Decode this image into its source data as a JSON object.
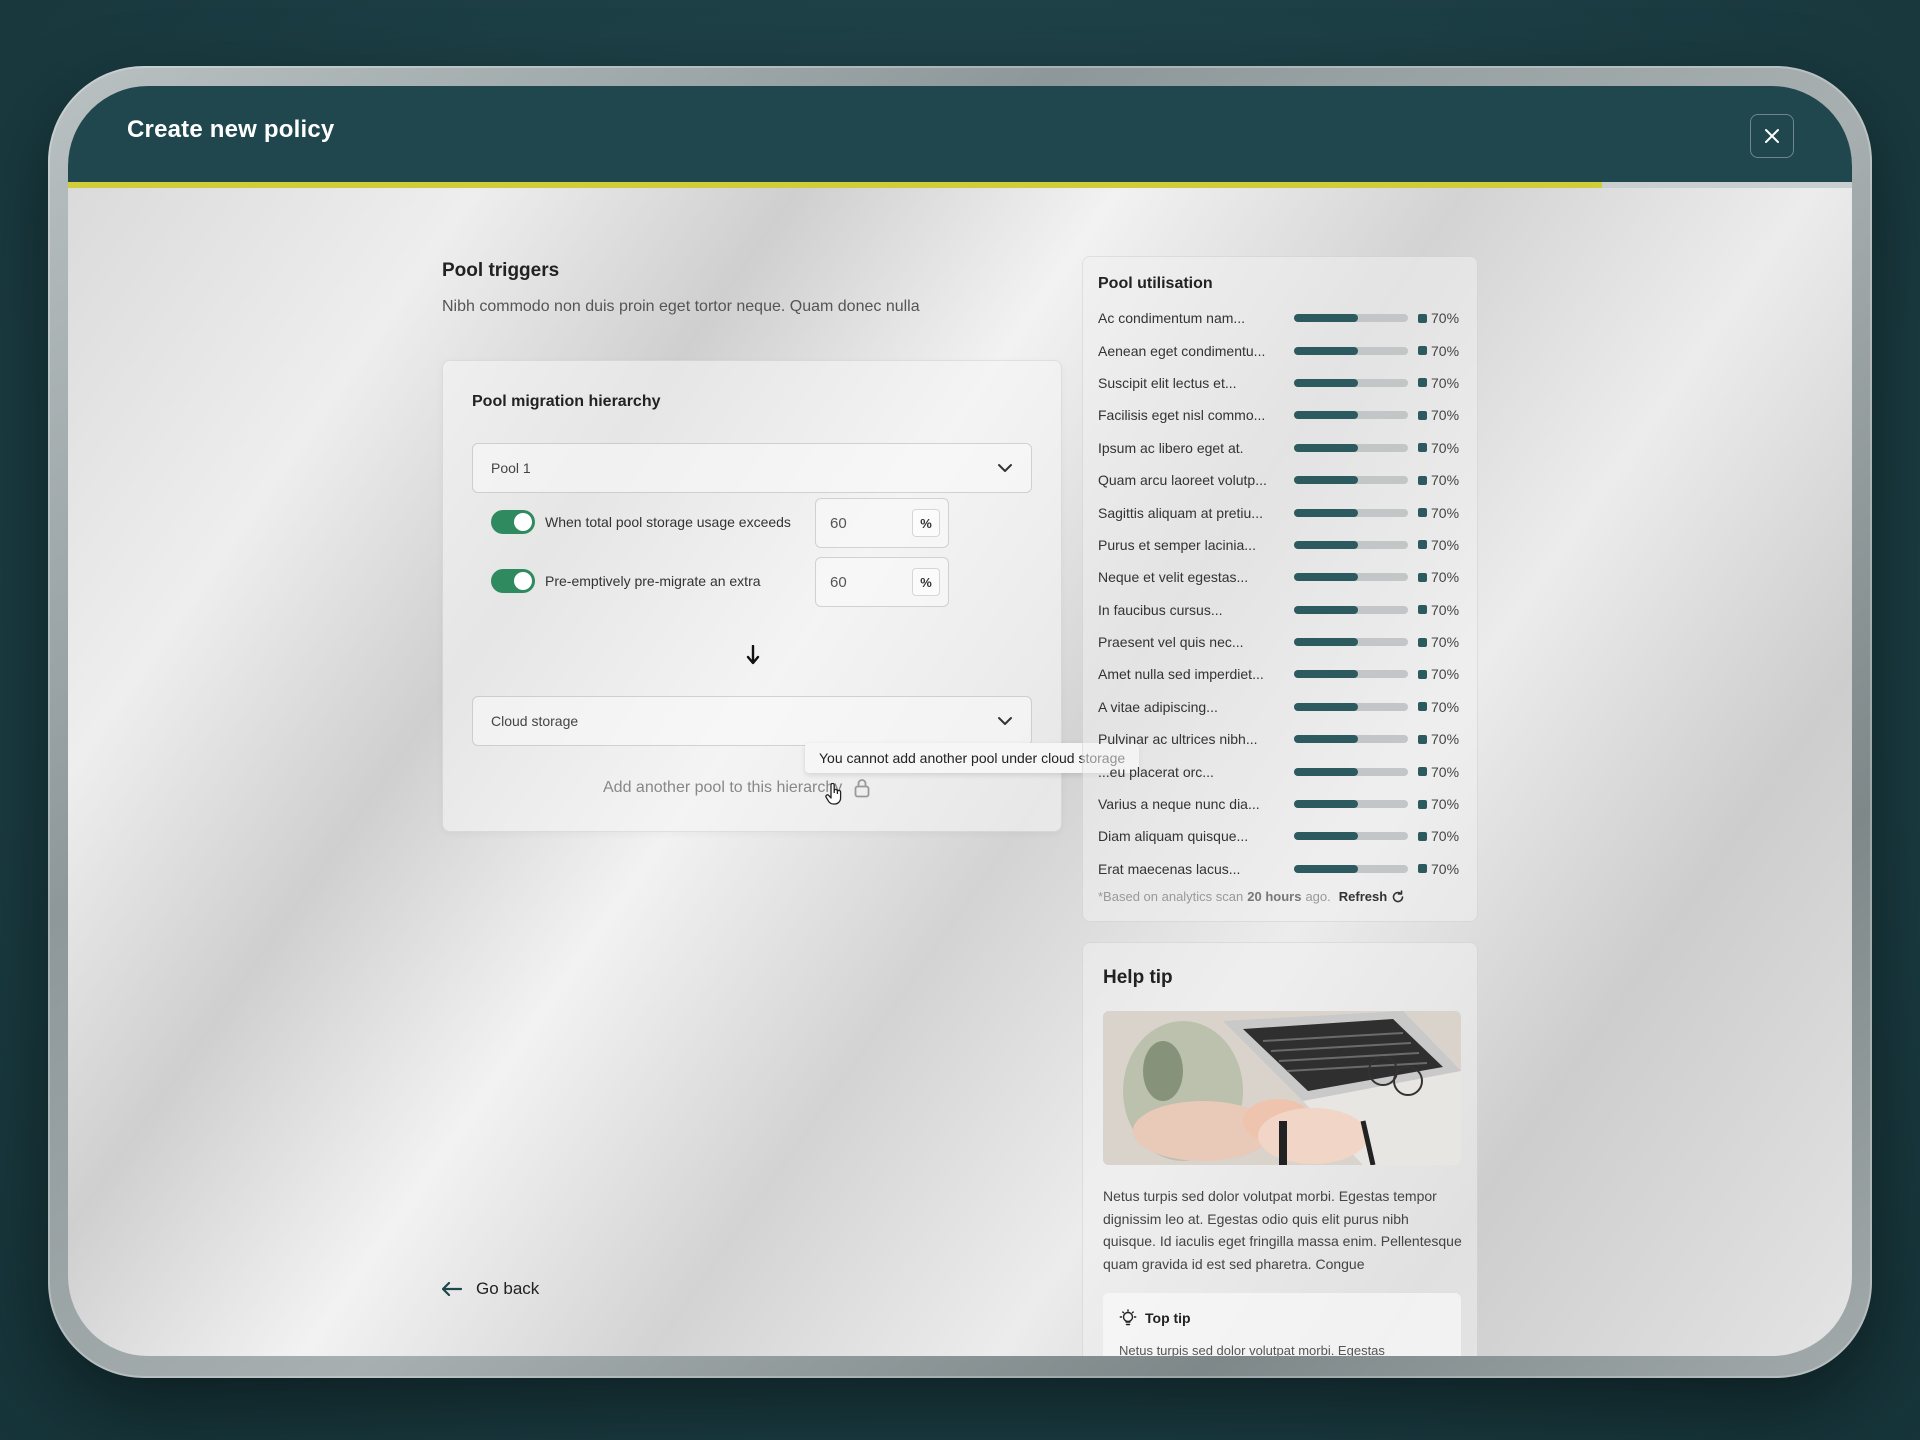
{
  "dialog": {
    "title": "Create new policy",
    "progress": 0.86
  },
  "triggers": {
    "title": "Pool triggers",
    "description": "Nibh commodo non duis proin eget tortor neque. Quam donec nulla"
  },
  "hierarchy": {
    "title": "Pool migration hierarchy",
    "pool_select": "Pool 1",
    "trigger_1": {
      "label": "When total pool storage usage exceeds",
      "value": "60",
      "unit": "%",
      "enabled": true
    },
    "trigger_2": {
      "label": "Pre-emptively pre-migrate an extra",
      "value": "60",
      "unit": "%",
      "enabled": true
    },
    "storage_select": "Cloud storage",
    "add_pool": "Add another pool to this hierarchy",
    "tooltip": "You cannot add another pool under cloud storage"
  },
  "go_back": "Go back",
  "utilisation": {
    "title": "Pool utilisation",
    "items": [
      {
        "label": "Ac condimentum nam...",
        "pct": "70%",
        "value": 0.7
      },
      {
        "label": "Aenean eget condimentu...",
        "pct": "70%",
        "value": 0.7
      },
      {
        "label": "Suscipit elit lectus et...",
        "pct": "70%",
        "value": 0.7
      },
      {
        "label": "Facilisis eget nisl commo...",
        "pct": "70%",
        "value": 0.7
      },
      {
        "label": "Ipsum ac libero eget at.",
        "pct": "70%",
        "value": 0.7
      },
      {
        "label": "Quam arcu laoreet volutp...",
        "pct": "70%",
        "value": 0.7
      },
      {
        "label": "Sagittis aliquam at pretiu...",
        "pct": "70%",
        "value": 0.7
      },
      {
        "label": "Purus et semper lacinia...",
        "pct": "70%",
        "value": 0.7
      },
      {
        "label": "Neque et velit egestas...",
        "pct": "70%",
        "value": 0.7
      },
      {
        "label": "In faucibus cursus...",
        "pct": "70%",
        "value": 0.7
      },
      {
        "label": "Praesent vel quis nec...",
        "pct": "70%",
        "value": 0.7
      },
      {
        "label": "Amet nulla sed imperdiet...",
        "pct": "70%",
        "value": 0.7
      },
      {
        "label": "A vitae adipiscing...",
        "pct": "70%",
        "value": 0.7
      },
      {
        "label": "Pulvinar ac ultrices nibh...",
        "pct": "70%",
        "value": 0.7
      },
      {
        "label": "...eu placerat orc...",
        "pct": "70%",
        "value": 0.7
      },
      {
        "label": "Varius a neque nunc dia...",
        "pct": "70%",
        "value": 0.7
      },
      {
        "label": "Diam aliquam quisque...",
        "pct": "70%",
        "value": 0.7
      },
      {
        "label": "Erat maecenas lacus...",
        "pct": "70%",
        "value": 0.7
      }
    ],
    "foot_prefix": "*Based on analytics scan",
    "foot_time": "20 hours",
    "foot_suffix": "ago.",
    "refresh": "Refresh"
  },
  "help": {
    "title": "Help tip",
    "text": "Netus turpis sed dolor volutpat morbi. Egestas tempor dignissim leo at. Egestas odio quis elit purus nibh quisque. Id iaculis eget fringilla massa enim. Pellentesque quam gravida id est sed pharetra. Congue",
    "top_tip_title": "Top tip",
    "top_tip_text": "Netus turpis sed dolor volutpat morbi. Egestas"
  },
  "colors": {
    "accent": "#2f8a5f",
    "header": "#1f474d",
    "progress": "#d1cd39",
    "bar": "#2c5a5f"
  }
}
